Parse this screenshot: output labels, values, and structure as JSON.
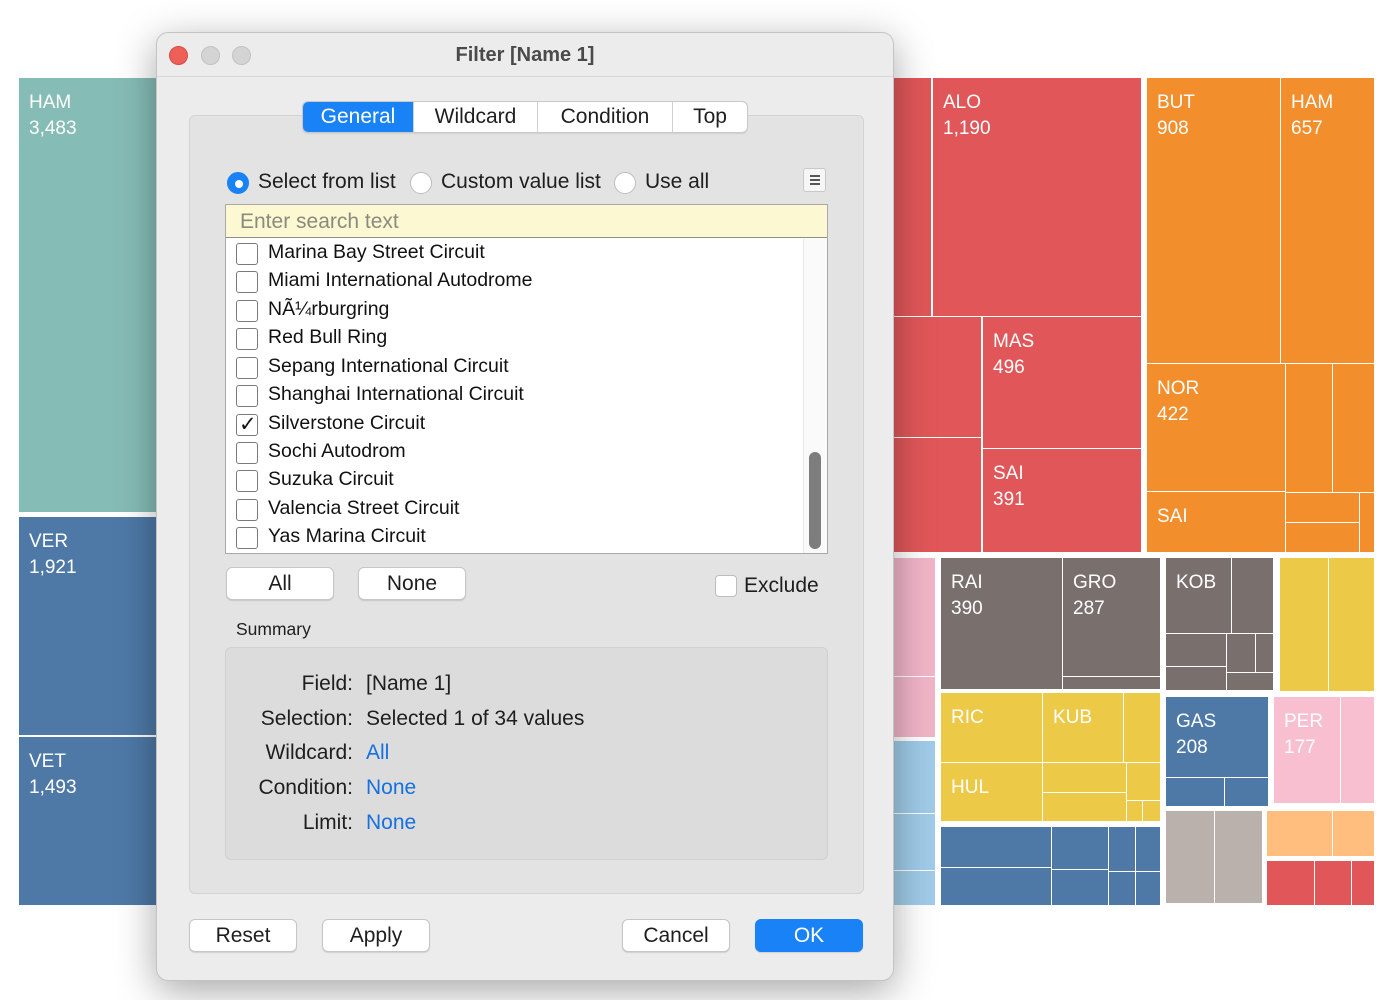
{
  "treemap": {
    "tiles": {
      "ham": {
        "code": "HAM",
        "value": "3,483"
      },
      "ver": {
        "code": "VER",
        "value": "1,921"
      },
      "vet": {
        "code": "VET",
        "value": "1,493"
      },
      "alo": {
        "code": "ALO",
        "value": "1,190"
      },
      "mas": {
        "code": "MAS",
        "value": "496"
      },
      "sai_red": {
        "code": "SAI",
        "value": "391"
      },
      "but": {
        "code": "BUT",
        "value": "908"
      },
      "ham_orange": {
        "code": "HAM",
        "value": "657"
      },
      "nor": {
        "code": "NOR",
        "value": "422"
      },
      "sai_orange": {
        "code": "SAI"
      },
      "rai": {
        "code": "RAI",
        "value": "390"
      },
      "gro": {
        "code": "GRO",
        "value": "287"
      },
      "kob": {
        "code": "KOB"
      },
      "ric": {
        "code": "RIC"
      },
      "kub": {
        "code": "KUB"
      },
      "hul": {
        "code": "HUL"
      },
      "gas": {
        "code": "GAS",
        "value": "208"
      },
      "per": {
        "code": "PER",
        "value": "177"
      }
    }
  },
  "dialog": {
    "title": "Filter [Name 1]",
    "tabs": [
      "General",
      "Wildcard",
      "Condition",
      "Top"
    ],
    "active_tab": "General",
    "modes": [
      "Select from list",
      "Custom value list",
      "Use all"
    ],
    "selected_mode": "Select from list",
    "search": {
      "placeholder": "Enter search text",
      "value": ""
    },
    "items": [
      {
        "label": "Marina Bay Street Circuit",
        "checked": false
      },
      {
        "label": "Miami International Autodrome",
        "checked": false
      },
      {
        "label": "NÃ¼rburgring",
        "checked": false
      },
      {
        "label": "Red Bull Ring",
        "checked": false
      },
      {
        "label": "Sepang International Circuit",
        "checked": false
      },
      {
        "label": "Shanghai International Circuit",
        "checked": false
      },
      {
        "label": "Silverstone Circuit",
        "checked": true
      },
      {
        "label": "Sochi Autodrom",
        "checked": false
      },
      {
        "label": "Suzuka Circuit",
        "checked": false
      },
      {
        "label": "Valencia Street Circuit",
        "checked": false
      },
      {
        "label": "Yas Marina Circuit",
        "checked": false
      }
    ],
    "all_label": "All",
    "none_label": "None",
    "exclude_label": "Exclude",
    "exclude_checked": false,
    "summary": {
      "heading": "Summary",
      "field_key": "Field:",
      "field_val": "[Name 1]",
      "selection_key": "Selection:",
      "selection_val": "Selected 1 of 34 values",
      "wildcard_key": "Wildcard:",
      "wildcard_val": "All",
      "condition_key": "Condition:",
      "condition_val": "None",
      "limit_key": "Limit:",
      "limit_val": "None"
    },
    "buttons": {
      "reset": "Reset",
      "apply": "Apply",
      "cancel": "Cancel",
      "ok": "OK"
    }
  },
  "colors": {
    "accent": "#1a82f7",
    "link": "#1670e0",
    "search_bg": "#fcf9d2"
  }
}
